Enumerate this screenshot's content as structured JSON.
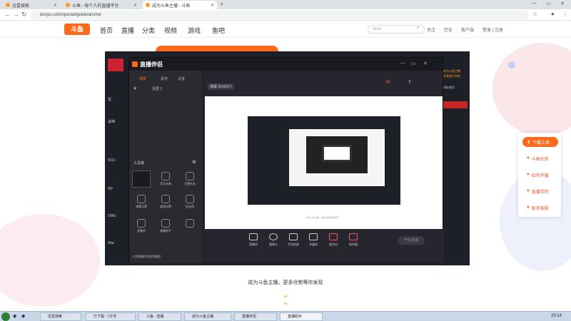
{
  "browser": {
    "tabs": [
      {
        "label": "迅雷搜索"
      },
      {
        "label": "斗鱼 - 每个人的直播平台"
      },
      {
        "label": "成为斗鱼主播 - 斗鱼"
      }
    ],
    "url": "douyu.com/special/guide/anchor"
  },
  "site": {
    "logo": "斗鱼",
    "nav": [
      "首页",
      "直播",
      "分类",
      "视频",
      "游戏",
      "鱼吧"
    ],
    "search_value": "Ariel",
    "header_links": [
      "关注",
      "历史",
      "客户端",
      "登录 | 注册"
    ]
  },
  "app": {
    "name": "直播伴侣",
    "left_tabs": [
      "场景",
      "素材",
      "设置"
    ],
    "scene": "全屏 1",
    "tools_title": "工具箱",
    "tools": [
      "",
      "音乐伴奏",
      "主播任务",
      "弹幕设置",
      "录制设置",
      "粉丝团",
      "直播间",
      "弹幕助手",
      "",
      "",
      "",
      ""
    ],
    "stats": "弹幕 5096327",
    "bottom_buttons": [
      "直播间",
      "摄像头",
      "手机投屏",
      "多媒体",
      "麦克风",
      "扬声器"
    ],
    "start_button": "开始直播",
    "footer": "斗鱼直播伴侣使用教程"
  },
  "left_streamers": [
    "雷",
    "战神",
    "9211",
    "RP",
    "OMG",
    "War"
  ],
  "side_menu": [
    {
      "label": "下载工具",
      "active": true
    },
    {
      "label": "斗鱼优势",
      "active": false
    },
    {
      "label": "如何开播",
      "active": false
    },
    {
      "label": "直播学院",
      "active": false
    },
    {
      "label": "联系客服",
      "active": false
    }
  ],
  "right_promo": [
    "成为斗鱼主播",
    "享受超凡特权",
    "领取福利"
  ],
  "caption": "成为斗鱼主播，更多优势等你发现",
  "taskbar": [
    {
      "label": "迅雷搜索"
    },
    {
      "label": "已下载 - 7文件"
    },
    {
      "label": "斗鱼 - 直播"
    },
    {
      "label": "成为斗鱼主播"
    },
    {
      "label": "直播伴侣"
    },
    {
      "label": "直播助手"
    }
  ],
  "clock": "23:14",
  "colors": {
    "accent": "#ff6a1a",
    "app_bg": "#26272e"
  }
}
